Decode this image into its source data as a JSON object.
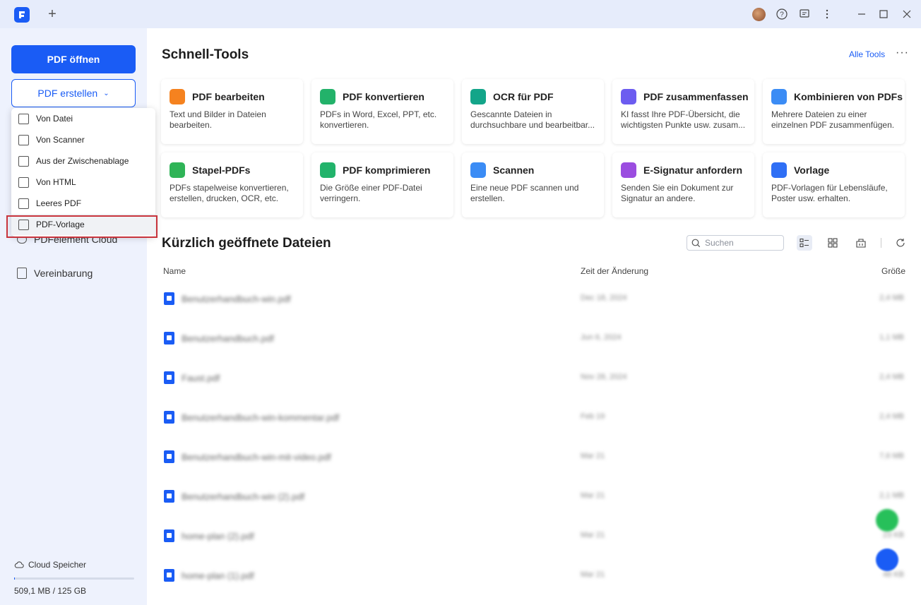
{
  "titlebar": {
    "new_tab": "+",
    "icons": [
      "user-avatar",
      "help-icon",
      "feedback-icon",
      "more-vertical-icon",
      "minimize-icon",
      "maximize-icon",
      "close-icon"
    ]
  },
  "sidebar": {
    "open_button": "PDF öffnen",
    "create_button": "PDF erstellen",
    "items": [
      {
        "label": "PDFelement Cloud",
        "icon": "cloud-icon"
      },
      {
        "label": "Vereinbarung",
        "icon": "document-icon"
      }
    ],
    "cloud": {
      "label": "Cloud Speicher",
      "usage": "509,1 MB / 125 GB"
    }
  },
  "dropdown": {
    "items": [
      {
        "label": "Von Datei",
        "icon": "folder-icon"
      },
      {
        "label": "Von Scanner",
        "icon": "scanner-icon"
      },
      {
        "label": "Aus der Zwischenablage",
        "icon": "clipboard-icon"
      },
      {
        "label": "Von HTML",
        "icon": "html-icon"
      },
      {
        "label": "Leeres PDF",
        "icon": "blank-page-icon"
      },
      {
        "label": "PDF-Vorlage",
        "icon": "template-icon",
        "highlighted": true
      }
    ]
  },
  "tools": {
    "title": "Schnell-Tools",
    "all_link": "Alle Tools",
    "more": "···",
    "cards": [
      {
        "title": "PDF bearbeiten",
        "desc": "Text und Bilder in Dateien bearbeiten.",
        "color": "#f5821f"
      },
      {
        "title": "PDF konvertieren",
        "desc": "PDFs in Word, Excel, PPT, etc. konvertieren.",
        "color": "#23b26a"
      },
      {
        "title": "OCR für PDF",
        "desc": "Gescannte Dateien in durchsuchbare und bearbeitbar...",
        "color": "#13a589"
      },
      {
        "title": "PDF zusammenfassen",
        "desc": "KI fasst Ihre PDF-Übersicht, die wichtigsten Punkte usw. zusam...",
        "color": "#6c5cf0"
      },
      {
        "title": "Kombinieren von PDFs",
        "desc": "Mehrere Dateien zu einer einzelnen PDF zusammenfügen.",
        "color": "#3b8cf5"
      },
      {
        "title": "Stapel-PDFs",
        "desc": "PDFs stapelweise konvertieren, erstellen, drucken, OCR, etc.",
        "color": "#2fb457"
      },
      {
        "title": "PDF komprimieren",
        "desc": "Die Größe einer PDF-Datei verringern.",
        "color": "#22b36b"
      },
      {
        "title": "Scannen",
        "desc": "Eine neue PDF scannen und erstellen.",
        "color": "#3b8cf5"
      },
      {
        "title": "E-Signatur anfordern",
        "desc": "Senden Sie ein Dokument zur Signatur an andere.",
        "color": "#9b4de0"
      },
      {
        "title": "Vorlage",
        "desc": "PDF-Vorlagen für Lebensläufe, Poster usw. erhalten.",
        "color": "#2f6ff5"
      }
    ]
  },
  "recent": {
    "title": "Kürzlich geöffnete Dateien",
    "search_placeholder": "Suchen",
    "columns": {
      "name": "Name",
      "modified": "Zeit der Änderung",
      "size": "Größe"
    },
    "files": [
      {
        "name": "Benutzerhandbuch-win.pdf",
        "date": "Dec 18, 2024",
        "size": "2,4 MB"
      },
      {
        "name": "Benutzerhandbuch.pdf",
        "date": "Jun 6, 2024",
        "size": "1,1 MB"
      },
      {
        "name": "Faust.pdf",
        "date": "Nov 28, 2024",
        "size": "2,4 MB"
      },
      {
        "name": "Benutzerhandbuch-win-kommentar.pdf",
        "date": "Feb 19",
        "size": "2,4 MB"
      },
      {
        "name": "Benutzerhandbuch-win-mit-video.pdf",
        "date": "Mar 21",
        "size": "7,6 MB"
      },
      {
        "name": "Benutzerhandbuch-win (2).pdf",
        "date": "Mar 21",
        "size": "2,1 MB"
      },
      {
        "name": "home-plan (2).pdf",
        "date": "Mar 21",
        "size": "23 KB"
      },
      {
        "name": "home-plan (1).pdf",
        "date": "Mar 21",
        "size": "48 KB"
      }
    ]
  },
  "colors": {
    "accent": "#1a5cf5",
    "sidebar_bg": "#eef2fd",
    "highlight_border": "#c8343c"
  }
}
